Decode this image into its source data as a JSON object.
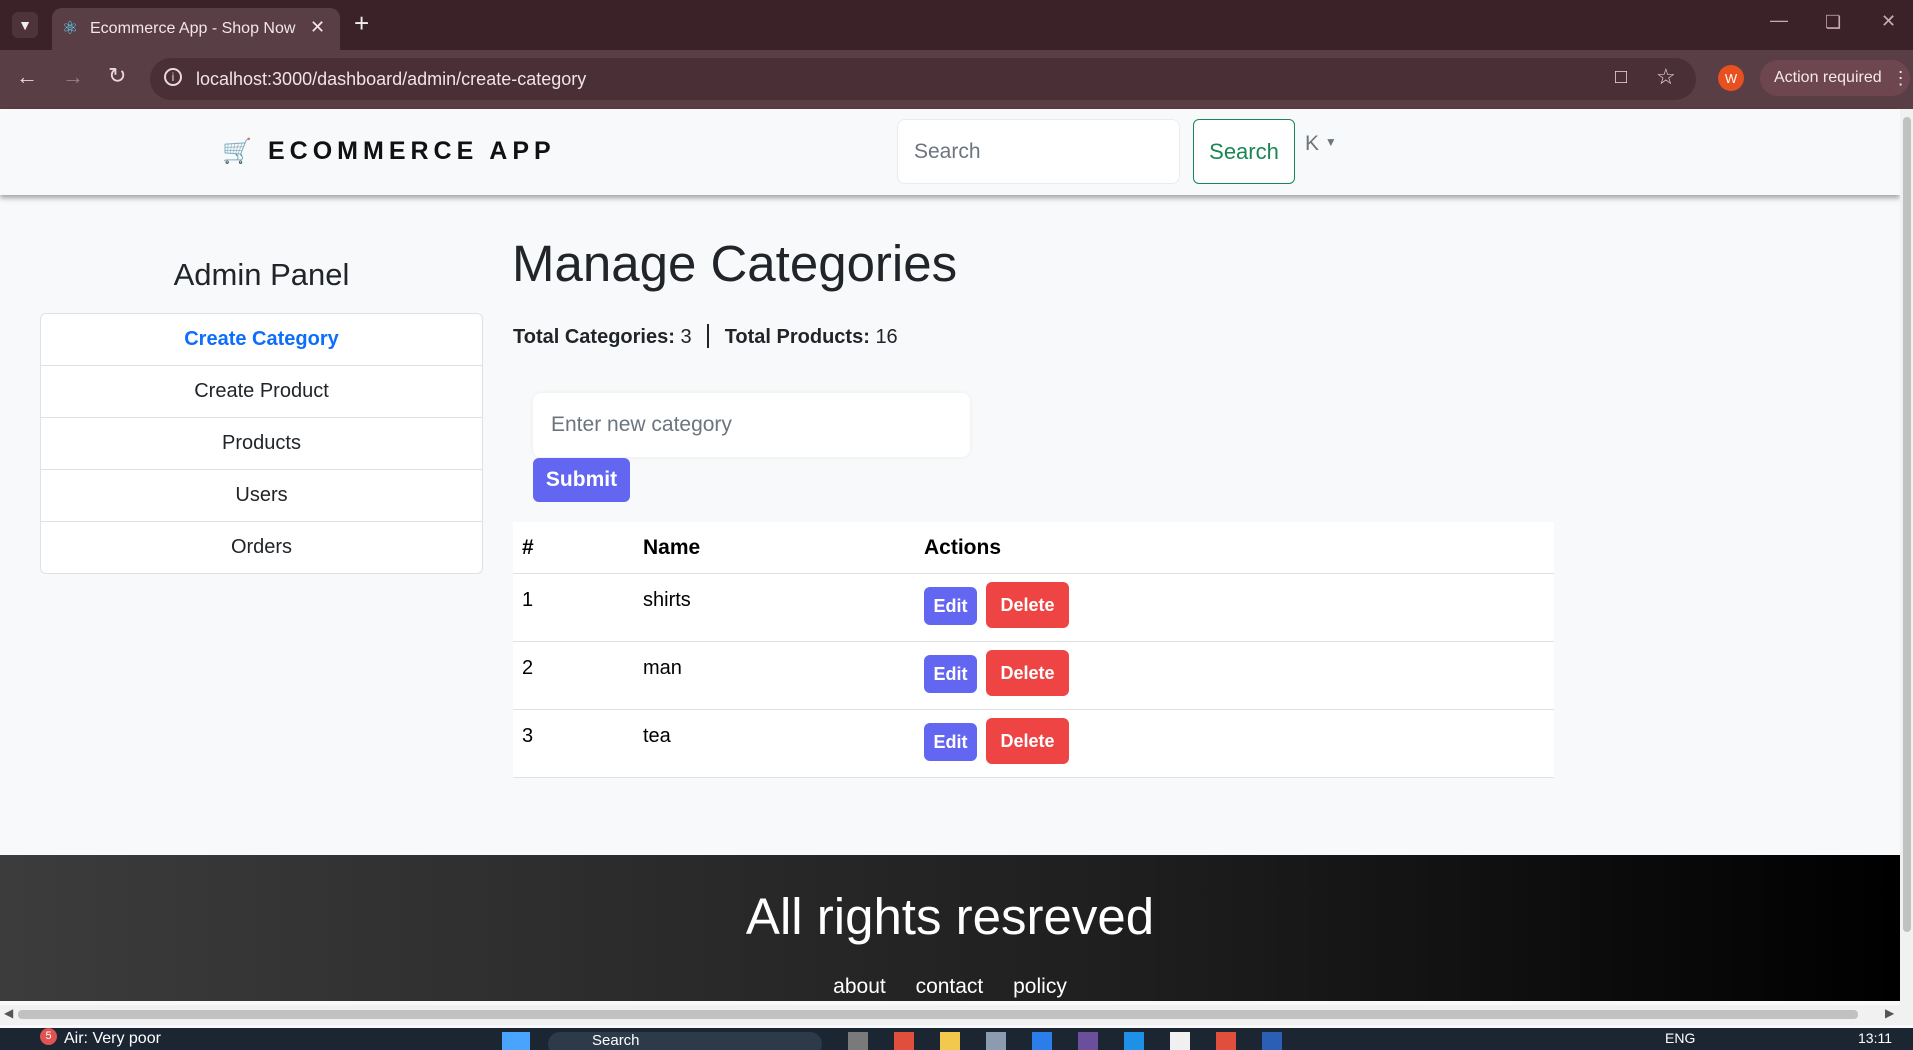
{
  "browser": {
    "tab_title": "Ecommerce App - Shop Now",
    "url": "localhost:3000/dashboard/admin/create-category",
    "profile_initial": "W",
    "action_label": "Action required"
  },
  "navbar": {
    "brand": "ECOMMERCE APP",
    "search_placeholder": "Search",
    "search_button": "Search",
    "user_initial": "K"
  },
  "sidebar": {
    "title": "Admin Panel",
    "items": [
      {
        "label": "Create Category"
      },
      {
        "label": "Create Product"
      },
      {
        "label": "Products"
      },
      {
        "label": "Users"
      },
      {
        "label": "Orders"
      }
    ]
  },
  "main": {
    "heading": "Manage Categories",
    "stats": {
      "categories_label": "Total Categories:",
      "categories_value": "3",
      "products_label": "Total Products:",
      "products_value": "16"
    },
    "form": {
      "placeholder": "Enter new category",
      "submit": "Submit"
    },
    "table": {
      "headers": [
        "#",
        "Name",
        "Actions"
      ],
      "edit_label": "Edit",
      "delete_label": "Delete",
      "rows": [
        {
          "index": "1",
          "name": "shirts"
        },
        {
          "index": "2",
          "name": "man"
        },
        {
          "index": "3",
          "name": "tea"
        }
      ]
    }
  },
  "footer": {
    "title": "All rights resreved",
    "links": [
      "about",
      "contact",
      "policy"
    ]
  },
  "taskbar": {
    "weather_badge": "5",
    "weather": "Air: Very poor",
    "search": "Search",
    "lang": "ENG",
    "time": "13:11"
  },
  "colors": {
    "accent": "#6366f1",
    "danger": "#ef4444",
    "link_active": "#0d6efd",
    "search_green": "#198754"
  }
}
